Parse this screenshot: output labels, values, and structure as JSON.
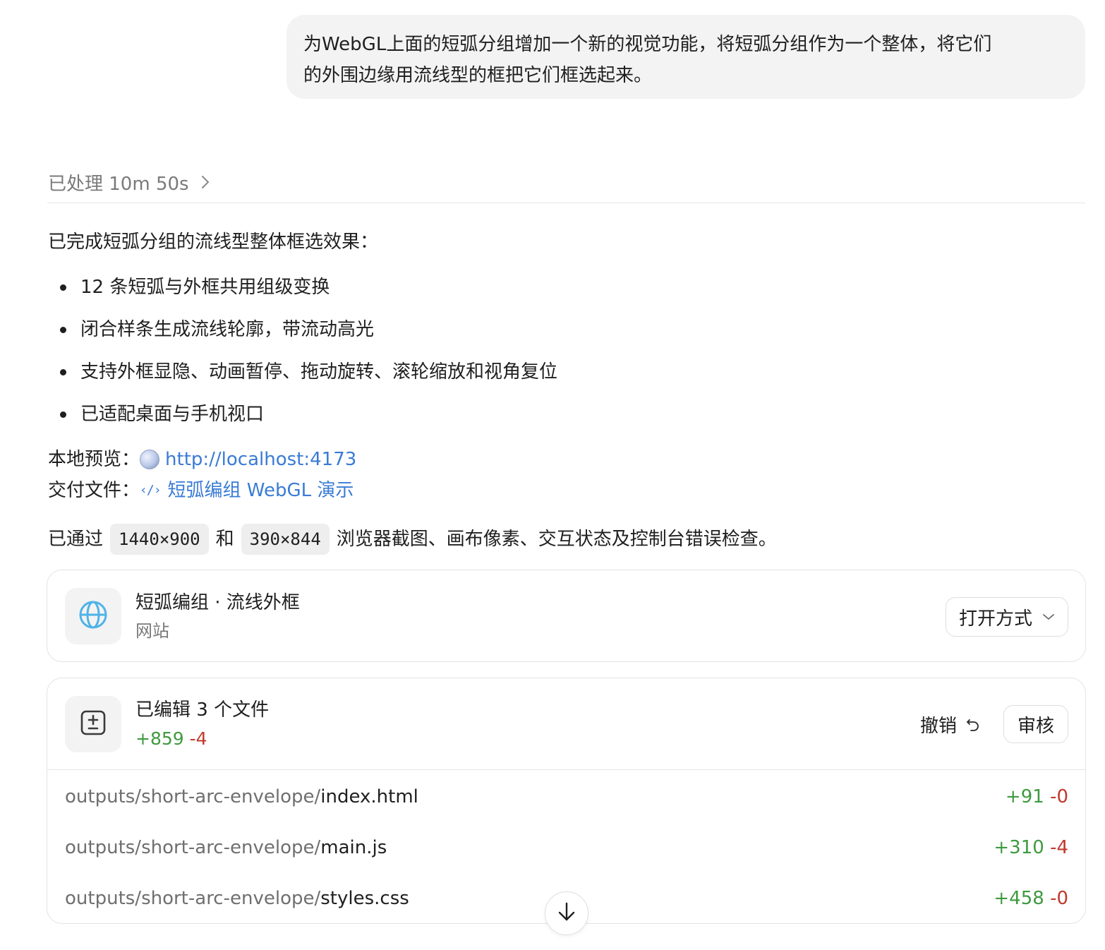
{
  "user_message": {
    "line1": "为WebGL上面的短弧分组增加一个新的视觉功能，将短弧分组作为一个整体，将它们",
    "line2": "的外围边缘用流线型的框把它们框选起来。"
  },
  "processing": {
    "label": "已处理 10m 50s"
  },
  "response": {
    "intro": "已完成短弧分组的流线型整体框选效果：",
    "bullets": [
      "12 条短弧与外框共用组级变换",
      "闭合样条生成流线轮廓，带流动高光",
      "支持外框显隐、动画暂停、拖动旋转、滚轮缩放和视角复位",
      "已适配桌面与手机视口"
    ],
    "preview_label": "本地预览：",
    "preview_link": "http://localhost:4173",
    "deliver_label": "交付文件：",
    "deliver_link": "短弧编组 WebGL 演示",
    "verify_prefix": "已通过",
    "verify_chip1": "1440×900",
    "verify_and": "和",
    "verify_chip2": "390×844",
    "verify_suffix": "浏览器截图、画布像素、交互状态及控制台错误检查。"
  },
  "site_card": {
    "title": "短弧编组 · 流线外框",
    "subtitle": "网站",
    "open_with_label": "打开方式",
    "icon": "globe-icon"
  },
  "edits_card": {
    "title": "已编辑 3 个文件",
    "added": "+859",
    "removed": "-4",
    "undo_label": "撤销",
    "review_label": "审核",
    "icon": "diff-icon",
    "files": [
      {
        "dir": "outputs/short-arc-envelope/",
        "name": "index.html",
        "added": "+91",
        "removed": "-0"
      },
      {
        "dir": "outputs/short-arc-envelope/",
        "name": "main.js",
        "added": "+310",
        "removed": "-4"
      },
      {
        "dir": "outputs/short-arc-envelope/",
        "name": "styles.css",
        "added": "+458",
        "removed": "-0"
      }
    ]
  },
  "colors": {
    "added": "#3f9a3f",
    "removed": "#c0392b",
    "link": "#3a7bd5",
    "globe": "#4fb3e8"
  }
}
